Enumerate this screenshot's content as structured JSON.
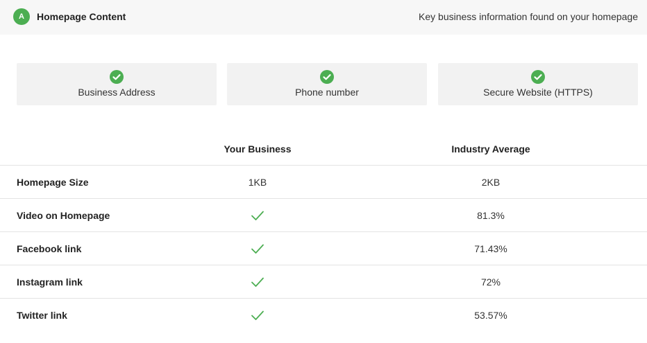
{
  "header": {
    "grade": "A",
    "title": "Homepage Content",
    "subtitle": "Key business information found on your homepage"
  },
  "checks": [
    {
      "label": "Business Address",
      "icon": "check-circle-icon",
      "passed": true
    },
    {
      "label": "Phone number",
      "icon": "check-circle-icon",
      "passed": true
    },
    {
      "label": "Secure Website (HTTPS)",
      "icon": "check-circle-icon",
      "passed": true
    }
  ],
  "table": {
    "columns": [
      "Your Business",
      "Industry Average"
    ],
    "rows": [
      {
        "label": "Homepage Size",
        "yours": "1KB",
        "industry": "2KB"
      },
      {
        "label": "Video on Homepage",
        "yours": "check",
        "industry": "81.3%"
      },
      {
        "label": "Facebook link",
        "yours": "check",
        "industry": "71.43%"
      },
      {
        "label": "Instagram link",
        "yours": "check",
        "industry": "72%"
      },
      {
        "label": "Twitter link",
        "yours": "check",
        "industry": "53.57%"
      }
    ]
  },
  "colors": {
    "accent_green": "#4cae52",
    "header_bg": "#f7f7f7",
    "card_bg": "#f2f2f2",
    "divider": "#e3e3e3"
  }
}
